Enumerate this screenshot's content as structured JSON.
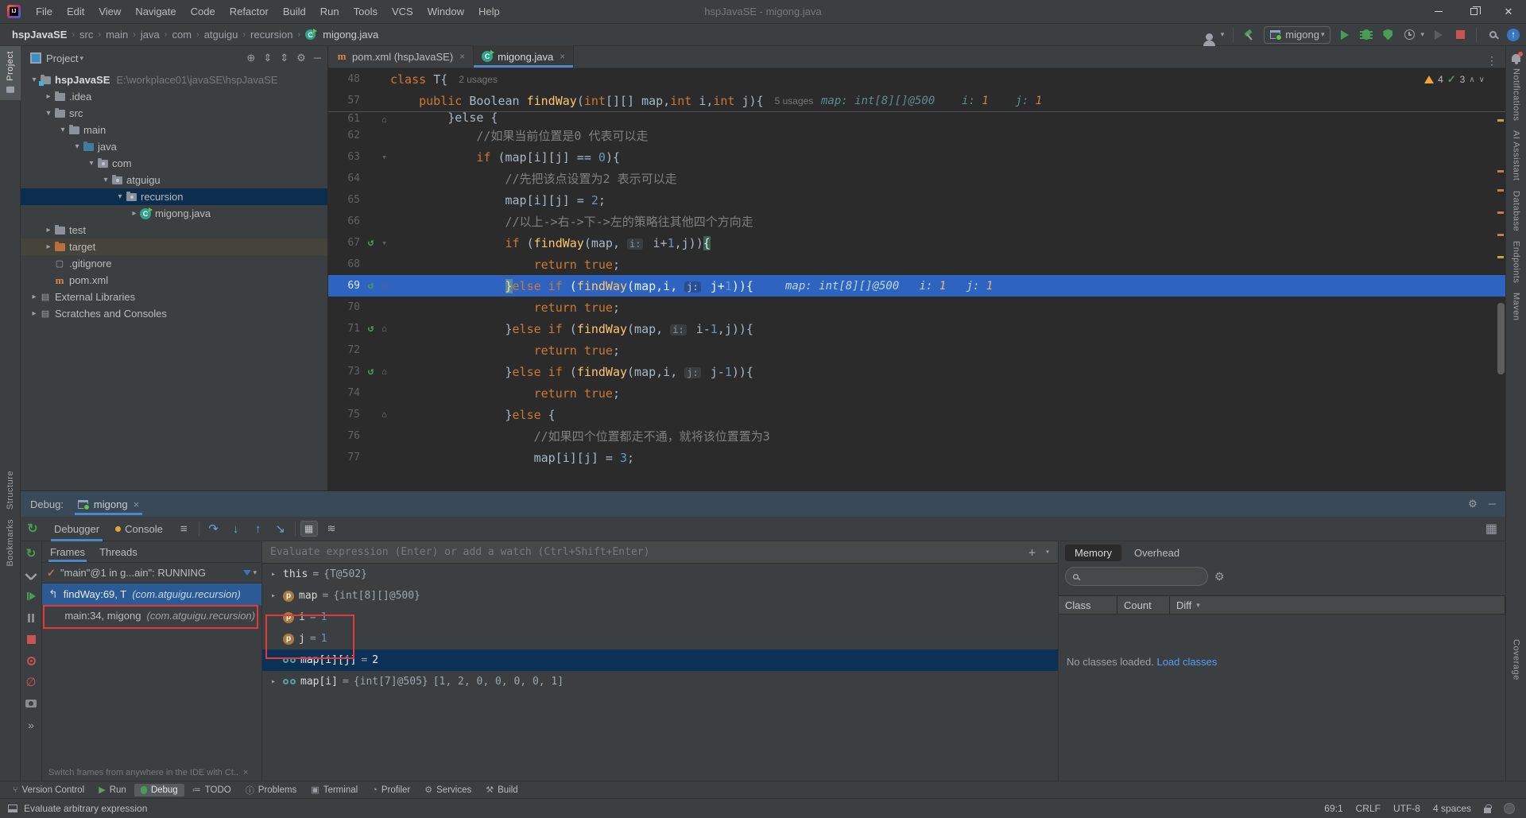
{
  "window": {
    "title": "hspJavaSE - migong.java",
    "menus": [
      "File",
      "Edit",
      "View",
      "Navigate",
      "Code",
      "Refactor",
      "Build",
      "Run",
      "Tools",
      "VCS",
      "Window",
      "Help"
    ]
  },
  "navbar": {
    "breadcrumbs": [
      "hspJavaSE",
      "src",
      "main",
      "java",
      "com",
      "atguigu",
      "recursion",
      "migong.java"
    ],
    "run_config": "migong"
  },
  "stripes": {
    "left_top": [
      "Project"
    ],
    "left_bottom": [
      "Structure",
      "Bookmarks"
    ],
    "right_top": [
      "Notifications",
      "AI Assistant",
      "Database",
      "Endpoints",
      "Maven"
    ],
    "right_bottom": [
      "Coverage"
    ]
  },
  "project": {
    "title": "Project",
    "tree": [
      {
        "label": "hspJavaSE",
        "path": "E:\\workplace01\\javaSE\\hspJavaSE",
        "depth": 0,
        "chev": "v",
        "icon": "project",
        "bold": true
      },
      {
        "label": ".idea",
        "depth": 1,
        "chev": ">",
        "icon": "folder"
      },
      {
        "label": "src",
        "depth": 1,
        "chev": "v",
        "icon": "folder"
      },
      {
        "label": "main",
        "depth": 2,
        "chev": "v",
        "icon": "folder"
      },
      {
        "label": "java",
        "depth": 3,
        "chev": "v",
        "icon": "srcfolder"
      },
      {
        "label": "com",
        "depth": 4,
        "chev": "v",
        "icon": "pkg"
      },
      {
        "label": "atguigu",
        "depth": 5,
        "chev": "v",
        "icon": "pkg"
      },
      {
        "label": "recursion",
        "depth": 6,
        "chev": "v",
        "icon": "pkg",
        "selected": true
      },
      {
        "label": "migong.java",
        "depth": 7,
        "chev": ">",
        "icon": "class"
      },
      {
        "label": "test",
        "depth": 1,
        "chev": ">",
        "icon": "folder"
      },
      {
        "label": "target",
        "depth": 1,
        "chev": ">",
        "icon": "folder-ex",
        "tint": true
      },
      {
        "label": ".gitignore",
        "depth": 1,
        "chev": "",
        "icon": "file"
      },
      {
        "label": "pom.xml",
        "depth": 1,
        "chev": "",
        "icon": "maven"
      },
      {
        "label": "External Libraries",
        "depth": 0,
        "chev": ">",
        "icon": "lib"
      },
      {
        "label": "Scratches and Consoles",
        "depth": 0,
        "chev": ">",
        "icon": "scratch"
      }
    ]
  },
  "editor": {
    "tabs": [
      {
        "label": "pom.xml (hspJavaSE)",
        "icon": "maven",
        "active": false
      },
      {
        "label": "migong.java",
        "icon": "class",
        "active": true
      }
    ],
    "inspections": {
      "warnings": "4",
      "ok": "3"
    },
    "lines": [
      {
        "n": "48",
        "ind": 0,
        "sticky": true,
        "tok": [
          [
            "k",
            "class "
          ],
          [
            "p",
            "T{"
          ]
        ],
        "usages": "2 usages"
      },
      {
        "n": "57",
        "ind": 4,
        "sticky": true,
        "tok": [
          [
            "k",
            "public "
          ],
          [
            "p",
            "Boolean "
          ],
          [
            "f",
            "findWay"
          ],
          [
            "p",
            "("
          ],
          [
            "k",
            "int"
          ],
          [
            "p",
            "[][] map,"
          ],
          [
            "k",
            "int"
          ],
          [
            "p",
            " i,"
          ],
          [
            "k",
            "int"
          ],
          [
            "p",
            " j){"
          ]
        ],
        "usages": "5 usages",
        "hint": [
          [
            "hl",
            "map: int[8][]@500    "
          ],
          [
            "hl",
            "i: "
          ],
          [
            "hn",
            "1"
          ],
          [
            "hl",
            "    j: "
          ],
          [
            "hn",
            "1"
          ]
        ],
        "hintx": 620
      },
      {
        "n": "61",
        "ind": 8,
        "clip": true,
        "fold": "end",
        "tok": [
          [
            "p",
            "}else {"
          ]
        ]
      },
      {
        "n": "62",
        "ind": 12,
        "tok": [
          [
            "cm",
            "//如果当前位置是0 代表可以走"
          ]
        ]
      },
      {
        "n": "63",
        "ind": 12,
        "fold": "open",
        "tok": [
          [
            "k",
            "if"
          ],
          [
            "p",
            " (map[i][j] == "
          ],
          [
            "n",
            "0"
          ],
          [
            "p",
            "){"
          ]
        ]
      },
      {
        "n": "64",
        "ind": 16,
        "tok": [
          [
            "cm",
            "//先把该点设置为2 表示可以走"
          ]
        ]
      },
      {
        "n": "65",
        "ind": 16,
        "tok": [
          [
            "p",
            "map[i][j] = "
          ],
          [
            "n",
            "2"
          ],
          [
            "p",
            ";"
          ]
        ]
      },
      {
        "n": "66",
        "ind": 16,
        "tok": [
          [
            "cm",
            "//以上->右->下->左的策略往其他四个方向走"
          ]
        ]
      },
      {
        "n": "67",
        "ind": 16,
        "rec": true,
        "fold": "open",
        "tok": [
          [
            "k",
            "if"
          ],
          [
            "p",
            " ("
          ],
          [
            "f",
            "findWay"
          ],
          [
            "p",
            "(map, "
          ],
          [
            "chip",
            "i:"
          ],
          [
            "p",
            " i+"
          ],
          [
            "n",
            "1"
          ],
          [
            "p",
            ",j))"
          ],
          [
            "mb",
            "{"
          ]
        ]
      },
      {
        "n": "68",
        "ind": 20,
        "tok": [
          [
            "k",
            "return "
          ],
          [
            "k",
            "true"
          ],
          [
            "p",
            ";"
          ]
        ]
      },
      {
        "n": "69",
        "ind": 16,
        "rec": true,
        "exec": true,
        "fold": "end",
        "tok": [
          [
            "br",
            "}"
          ],
          [
            "k",
            "else if"
          ],
          [
            "p",
            " ("
          ],
          [
            "f",
            "findWay"
          ],
          [
            "p",
            "(map,i, "
          ],
          [
            "chip",
            "j:"
          ],
          [
            "p",
            " j+"
          ],
          [
            "n",
            "1"
          ],
          [
            "p",
            ")){"
          ]
        ],
        "hint": [
          [
            "hl",
            "map: int[8][]@500   "
          ],
          [
            "hl",
            "i: "
          ],
          [
            "hn",
            "1"
          ],
          [
            "hl",
            "   j: "
          ],
          [
            "hn",
            "1"
          ]
        ],
        "hintx": 575
      },
      {
        "n": "70",
        "ind": 20,
        "tok": [
          [
            "k",
            "return "
          ],
          [
            "k",
            "true"
          ],
          [
            "p",
            ";"
          ]
        ]
      },
      {
        "n": "71",
        "ind": 16,
        "rec": true,
        "fold": "end",
        "tok": [
          [
            "p",
            "}"
          ],
          [
            "k",
            "else if"
          ],
          [
            "p",
            " ("
          ],
          [
            "f",
            "findWay"
          ],
          [
            "p",
            "(map, "
          ],
          [
            "chip",
            "i:"
          ],
          [
            "p",
            " i-"
          ],
          [
            "n",
            "1"
          ],
          [
            "p",
            ",j)){"
          ]
        ]
      },
      {
        "n": "72",
        "ind": 20,
        "tok": [
          [
            "k",
            "return "
          ],
          [
            "k",
            "true"
          ],
          [
            "p",
            ";"
          ]
        ]
      },
      {
        "n": "73",
        "ind": 16,
        "rec": true,
        "fold": "end",
        "tok": [
          [
            "p",
            "}"
          ],
          [
            "k",
            "else if"
          ],
          [
            "p",
            " ("
          ],
          [
            "f",
            "findWay"
          ],
          [
            "p",
            "(map,i, "
          ],
          [
            "chip",
            "j:"
          ],
          [
            "p",
            " j-"
          ],
          [
            "n",
            "1"
          ],
          [
            "p",
            ")){"
          ]
        ]
      },
      {
        "n": "74",
        "ind": 20,
        "tok": [
          [
            "k",
            "return "
          ],
          [
            "k",
            "true"
          ],
          [
            "p",
            ";"
          ]
        ]
      },
      {
        "n": "75",
        "ind": 16,
        "fold": "end",
        "tok": [
          [
            "p",
            "}"
          ],
          [
            "k",
            "else"
          ],
          [
            "p",
            " {"
          ]
        ]
      },
      {
        "n": "76",
        "ind": 20,
        "tok": [
          [
            "cm",
            "//如果四个位置都走不通，就将该位置置为3"
          ]
        ]
      },
      {
        "n": "77",
        "ind": 20,
        "tok": [
          [
            "p",
            "map[i][j] = "
          ],
          [
            "n",
            "3"
          ],
          [
            "p",
            ";"
          ]
        ]
      }
    ]
  },
  "debug": {
    "title": "Debug:",
    "session_tab": "migong",
    "view_tabs": [
      {
        "label": "Debugger",
        "active": true
      },
      {
        "label": "Console",
        "dot": true
      }
    ],
    "frames_tabs": [
      {
        "label": "Frames",
        "active": true
      },
      {
        "label": "Threads"
      }
    ],
    "thread": "\"main\"@1 in g...ain\": RUNNING",
    "frames": [
      {
        "text": "findWay:69, T ",
        "pkg": "(com.atguigu.recursion)",
        "selected": true
      },
      {
        "text": "main:34, migong ",
        "pkg": "(com.atguigu.recursion)"
      }
    ],
    "frames_hint": "Switch frames from anywhere in the IDE with Ct..",
    "evaluate_placeholder": "Evaluate expression (Enter) or add a watch (Ctrl+Shift+Enter)",
    "variables": [
      {
        "expand": true,
        "icon": "",
        "name": "this",
        "value": "{T@502}",
        "vtype": "obj"
      },
      {
        "expand": true,
        "icon": "p",
        "name": "map",
        "value": "{int[8][]@500}",
        "vtype": "obj"
      },
      {
        "expand": false,
        "icon": "p",
        "name": "i",
        "value": "1",
        "vtype": "num"
      },
      {
        "expand": false,
        "icon": "p",
        "name": "j",
        "value": "1",
        "vtype": "num"
      },
      {
        "expand": false,
        "icon": "watch",
        "name": "map[i][j]",
        "value": "2",
        "vtype": "num",
        "selected": true
      },
      {
        "expand": true,
        "icon": "watch",
        "name": "map[i]",
        "value": "{int[7]@505}",
        "vtype": "obj",
        "preview": " [1, 2, 0, 0, 0, 0, 1]"
      }
    ]
  },
  "memory": {
    "tabs": [
      {
        "label": "Memory",
        "active": true
      },
      {
        "label": "Overhead"
      }
    ],
    "columns": [
      "Class",
      "Count",
      "Diff"
    ],
    "empty_text": "No classes loaded.",
    "load_link": "Load classes"
  },
  "toolwindow_bar": [
    {
      "label": "Version Control",
      "icon": "vc"
    },
    {
      "label": "Run",
      "icon": "run"
    },
    {
      "label": "Debug",
      "icon": "bug",
      "active": true
    },
    {
      "label": "TODO",
      "icon": "todo"
    },
    {
      "label": "Problems",
      "icon": "problems"
    },
    {
      "label": "Terminal",
      "icon": "terminal"
    },
    {
      "label": "Profiler",
      "icon": "profiler"
    },
    {
      "label": "Services",
      "icon": "services"
    },
    {
      "label": "Build",
      "icon": "build"
    }
  ],
  "statusbar": {
    "left": "Evaluate arbitrary expression",
    "line_col": "69:1",
    "line_sep": "CRLF",
    "encoding": "UTF-8",
    "indent": "4 spaces"
  }
}
